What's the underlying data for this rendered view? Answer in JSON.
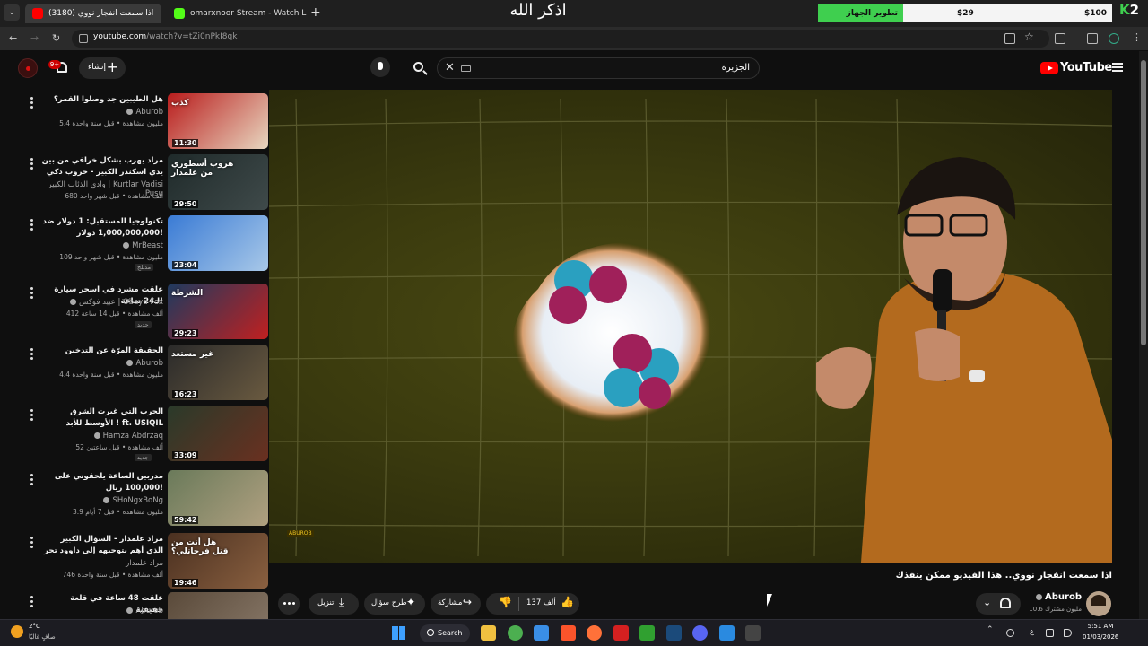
{
  "browser": {
    "tabs": [
      {
        "label": "(3180) اذا سمعت انفجار نووي",
        "active": true,
        "favicon_color": "#ff0000"
      },
      {
        "label": "omarxnoor Stream - Watch Live",
        "active": false,
        "favicon_color": "#53fc18"
      }
    ],
    "url_host": "youtube.com",
    "url_path": "/watch?v=tZi0nPkI8qk"
  },
  "overlay": {
    "center_text": "اذكر الله",
    "progress_label": "تطوير الجهاز",
    "progress_current": "$29",
    "progress_goal": "$100",
    "brand_k": "K",
    "brand_2": "2"
  },
  "youtube_header": {
    "logo_text": "YouTube",
    "search_value": "الجزيرة",
    "create_label": "إنشاء",
    "notifications_badge": "9+"
  },
  "recommendations": [
    {
      "title": "هل الطيبين جد وصلوا القمر؟",
      "channel": "Aburob",
      "verified": true,
      "meta": "5.4 مليون مشاهدة • قبل سنة واحدة",
      "duration": "11:30",
      "thumb_colors": [
        "#b91c1c",
        "#e8d7c0"
      ],
      "thumb_text": "كذب",
      "tag": ""
    },
    {
      "title": "مراد يهرب بشكل خرافي من بين يدي اسكندر الكبير - حروب ذكي",
      "channel": "وادي الذئاب الكبير | Kurtlar Vadisi Pusu",
      "verified": false,
      "meta": "680 ألف مشاهدة • قبل شهر واحد",
      "duration": "29:50",
      "thumb_colors": [
        "#1f2a2a",
        "#3f4a4a"
      ],
      "thumb_text": "هروب أسطوري من علمدار",
      "tag": ""
    },
    {
      "title": "تكنولوجيا المستقبل: 1 دولار ضد 1,000,000,000 دولار!",
      "channel": "MrBeast",
      "verified": true,
      "meta": "109 مليون مشاهدة • قبل شهر واحد",
      "duration": "23:04",
      "thumb_colors": [
        "#3a7bd5",
        "#a8c8e8"
      ],
      "thumb_text": "",
      "tag": "مدبلج"
    },
    {
      "title": "علقت مشرد في اسحر سيارة لـ24 ساعة!",
      "channel": "عبيد فوكس | Obayd Fox",
      "verified": true,
      "meta": "412 ألف مشاهدة • قبل 14 ساعة",
      "duration": "29:23",
      "thumb_colors": [
        "#1e3a5f",
        "#c02020"
      ],
      "thumb_text": "الشرطة",
      "tag": "جديد"
    },
    {
      "title": "الحقيقة المرّة عن التدخين",
      "channel": "Aburob",
      "verified": true,
      "meta": "4.4 مليون مشاهدة • قبل سنة واحدة",
      "duration": "16:23",
      "thumb_colors": [
        "#2a2a2a",
        "#6a5a40"
      ],
      "thumb_text": "غير مستعد",
      "tag": ""
    },
    {
      "title": "الحرب التي غيرت الشرق الأوسط للأبد ! ft. USIQIL",
      "channel": "Hamza Abdrzaq",
      "verified": true,
      "meta": "52 ألف مشاهدة • قبل ساعتين",
      "duration": "33:09",
      "thumb_colors": [
        "#2a3a2a",
        "#6a3020"
      ],
      "thumb_text": "",
      "tag": "جديد"
    },
    {
      "title": "مدربين الساعة يلحقوني على 100,000 ريال!",
      "channel": "SHoNgxBoNg",
      "verified": true,
      "meta": "3.9 مليون مشاهدة • قبل 7 أيام",
      "duration": "59:42",
      "thumb_colors": [
        "#6a7a5a",
        "#b0a080"
      ],
      "thumb_text": "",
      "tag": ""
    },
    {
      "title": "مراد علمدار - السؤال الكبير الذي أهم بتوجيهه إلى داوود تحر ارطل",
      "channel": "مراد علمدار",
      "verified": false,
      "meta": "746 ألف مشاهدة • قبل سنة واحدة",
      "duration": "19:46",
      "thumb_colors": [
        "#4a3020",
        "#8a6040"
      ],
      "thumb_text": "هل أنت من قتل فرحاتلي؟",
      "tag": ""
    },
    {
      "title": "علقت 48 ساعة في قلعة حقيقية",
      "channel": "Aburob",
      "verified": true,
      "meta": "",
      "duration": "",
      "thumb_colors": [
        "#5a4a3a",
        "#8a7a6a"
      ],
      "thumb_text": "",
      "tag": ""
    }
  ],
  "video": {
    "title": "اذا سمعت انفجار نووي.. هذا الفيديو ممكن ينقذك",
    "channel": "Aburob",
    "subscribers": "10.6 مليون مشترك",
    "likes": "137 ألف",
    "share_label": "مشاركة",
    "ask_label": "طرح سؤال",
    "download_label": "تنزيل",
    "watermark": "ABUROB"
  },
  "taskbar": {
    "weather_temp": "2°C",
    "weather_desc": "صافٍ غالبًا",
    "search_label": "Search",
    "lang": "ع",
    "time": "5:51 AM",
    "date": "01/03/2026",
    "apps": [
      {
        "name": "file-explorer-icon",
        "color": "#f0c040"
      },
      {
        "name": "chrome-icon",
        "color": "#4caf50"
      },
      {
        "name": "store-icon",
        "color": "#3a8ee6"
      },
      {
        "name": "brave-icon",
        "color": "#fb542b"
      },
      {
        "name": "firefox-icon",
        "color": "#ff7139"
      },
      {
        "name": "acrobat-icon",
        "color": "#d42020"
      },
      {
        "name": "xbox-icon",
        "color": "#30a030"
      },
      {
        "name": "steam-icon",
        "color": "#1b4a7a"
      },
      {
        "name": "discord-icon",
        "color": "#5865f2"
      },
      {
        "name": "vscode-icon",
        "color": "#2a8ae0"
      },
      {
        "name": "obs-icon",
        "color": "#444444"
      }
    ]
  }
}
